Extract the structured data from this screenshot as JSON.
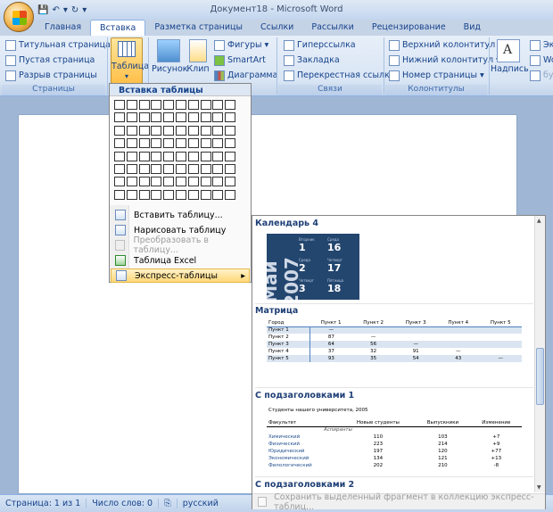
{
  "window": {
    "title": "Документ18 - Microsoft Word"
  },
  "tabs": [
    "Главная",
    "Вставка",
    "Разметка страницы",
    "Ссылки",
    "Рассылки",
    "Рецензирование",
    "Вид"
  ],
  "active_tab": "Вставка",
  "ribbon": {
    "pages": {
      "items": [
        "Титульная страница",
        "Пустая страница",
        "Разрыв страницы"
      ],
      "label": "Страницы"
    },
    "table": {
      "label": "Таблица"
    },
    "illustrations": {
      "picture": "Рисунок",
      "clip": "Клип",
      "shapes": "Фигуры",
      "smartart": "SmartArt",
      "chart": "Диаграмма"
    },
    "links": {
      "items": [
        "Гиперссылка",
        "Закладка",
        "Перекрестная ссылка"
      ],
      "label": "Связи"
    },
    "header_footer": {
      "items": [
        "Верхний колонтитул",
        "Нижний колонтитул",
        "Номер страницы"
      ],
      "label": "Колонтитулы"
    },
    "text": {
      "textbox": "Надпись",
      "e1": "Эк",
      "e2": "Wo",
      "e3": "бук"
    }
  },
  "table_menu": {
    "header": "Вставка таблицы",
    "grid": {
      "cols": 10,
      "rows": 8
    },
    "items": [
      {
        "label": "Вставить таблицу...",
        "enabled": true
      },
      {
        "label": "Нарисовать таблицу",
        "enabled": true
      },
      {
        "label": "Преобразовать в таблицу...",
        "enabled": false
      },
      {
        "label": "Таблица Excel",
        "enabled": true
      },
      {
        "label": "Экспресс-таблицы",
        "enabled": true,
        "submenu": true
      }
    ],
    "arrow": "▸"
  },
  "gallery": {
    "sections": [
      {
        "title": "Календарь 4",
        "calendar": {
          "year": "Май 2007",
          "days": [
            {
              "name": "Вторник",
              "num": "1"
            },
            {
              "name": "Среда",
              "num": "16"
            },
            {
              "name": "Среда",
              "num": "2"
            },
            {
              "name": "Четверг",
              "num": "17"
            },
            {
              "name": "Четверг",
              "num": "3"
            },
            {
              "name": "Пятница",
              "num": "18"
            }
          ]
        }
      },
      {
        "title": "Матрица",
        "matrix": {
          "header": [
            "Город",
            "Пункт 1",
            "Пункт 2",
            "Пункт 3",
            "Пункт 4",
            "Пункт 5"
          ],
          "rows": [
            [
              "Пункт 1",
              "—",
              "",
              "",
              "",
              ""
            ],
            [
              "Пункт 2",
              "87",
              "—",
              "",
              "",
              ""
            ],
            [
              "Пункт 3",
              "64",
              "56",
              "—",
              "",
              ""
            ],
            [
              "Пункт 4",
              "37",
              "32",
              "91",
              "—",
              ""
            ],
            [
              "Пункт 5",
              "93",
              "35",
              "54",
              "43",
              "—"
            ]
          ]
        }
      },
      {
        "title": "С подзаголовками 1",
        "sub1": {
          "caption": "Студенты нашего университета, 2005",
          "header": [
            "Факультет",
            "Новые студенты",
            "Выпускники",
            "Изменение"
          ],
          "subheader": "Аспиранты",
          "rows": [
            [
              "Химический",
              "110",
              "103",
              "+7"
            ],
            [
              "Физический",
              "223",
              "214",
              "+9"
            ],
            [
              "Юридический",
              "197",
              "120",
              "+77"
            ],
            [
              "Экономический",
              "134",
              "121",
              "+13"
            ],
            [
              "Филологический",
              "202",
              "210",
              "-8"
            ]
          ]
        }
      },
      {
        "title": "С подзаголовками 2"
      }
    ],
    "footer": "Сохранить выделенный фрагмент в коллекцию экспресс-таблиц..."
  },
  "status": {
    "page": "Страница: 1 из 1",
    "words": "Число слов: 0",
    "language": "русский"
  }
}
